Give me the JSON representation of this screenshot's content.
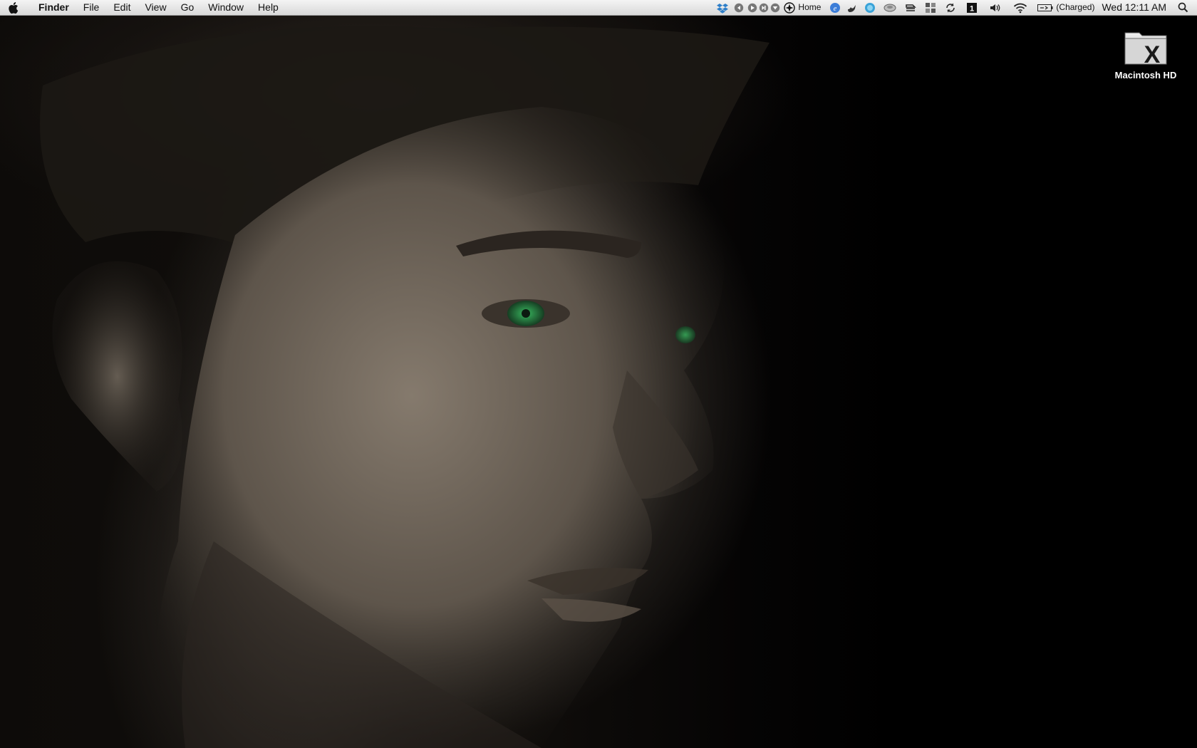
{
  "menubar": {
    "app_name": "Finder",
    "menus": [
      "File",
      "Edit",
      "View",
      "Go",
      "Window",
      "Help"
    ],
    "status": {
      "home_label": "Home",
      "battery_text": "(Charged)",
      "clock": "Wed 12:11 AM"
    },
    "status_icons": [
      "dropbox-icon",
      "media-previous-icon",
      "media-play-icon",
      "media-next-icon",
      "media-menu-icon",
      "compass-icon",
      "ie-icon",
      "bird-icon",
      "chat-icon",
      "drive-icon",
      "scanner-icon",
      "grid-icon",
      "sync-icon",
      "calendar-icon",
      "volume-icon",
      "wifi-icon",
      "battery-icon",
      "spotlight-icon"
    ]
  },
  "desktop": {
    "icons": [
      {
        "label": "Macintosh HD",
        "icon": "hard-drive-icon"
      }
    ]
  },
  "colors": {
    "menubar_top": "#f4f4f4",
    "menubar_bottom": "#d9d9d9",
    "wallpaper_bg": "#000000",
    "eye_green": "#2f9a52"
  }
}
